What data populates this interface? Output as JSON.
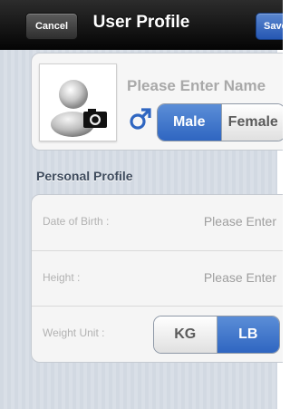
{
  "navbar": {
    "title": "User Profile",
    "cancel_label": "Cancel",
    "save_label": "Save"
  },
  "profile": {
    "avatar_icon": "user-silhouette-with-camera-icon",
    "name_placeholder": "Please Enter Name",
    "gender_icon": "male-symbol-icon",
    "gender_options": [
      "Male",
      "Female"
    ],
    "gender_selected": "Male"
  },
  "personal_profile": {
    "header": "Personal Profile",
    "date_of_birth": {
      "label": "Date of Birth :",
      "value": "Please Enter"
    },
    "height": {
      "label": "Height :",
      "value": "Please Enter"
    },
    "weight_unit": {
      "label": "Weight Unit :",
      "options": [
        "KG",
        "LB"
      ],
      "selected": "LB"
    }
  },
  "colors": {
    "accent": "#2f66c1",
    "navbar": "#0f0f0f",
    "background": "#d5dce4"
  }
}
